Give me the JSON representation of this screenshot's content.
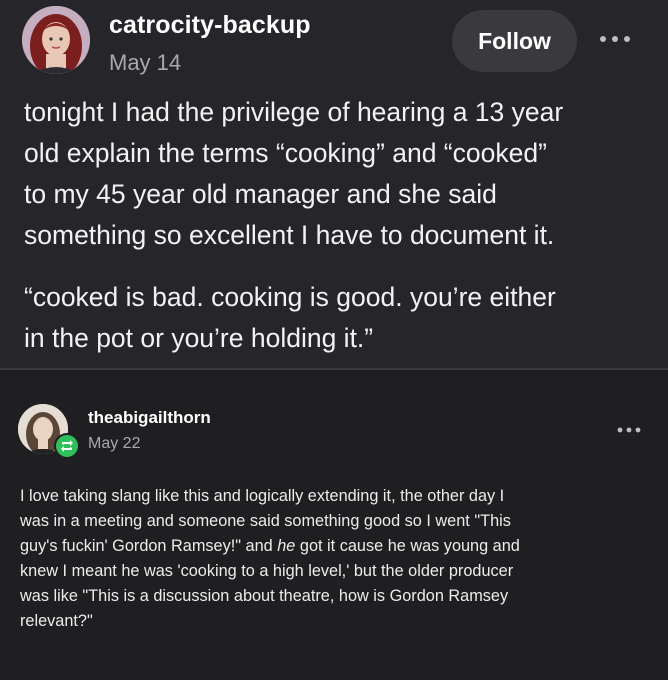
{
  "post": {
    "username": "catrocity-backup",
    "date": "May 14",
    "follow_label": "Follow",
    "more_icon": "ellipsis-icon",
    "body_lines": [
      "tonight I had the privilege of hearing a 13 year",
      "old explain the terms “cooking” and “cooked”",
      "to my 45 year old manager and she said",
      "something so excellent I have to document it."
    ],
    "quote_lines": [
      "“cooked is bad. cooking is good. you’re either",
      "in the pot or you’re holding it.”"
    ]
  },
  "reply": {
    "username": "theabigailthorn",
    "date": "May 22",
    "badge_icon": "reblog-icon",
    "more_icon": "ellipsis-icon",
    "lines": [
      "I love taking slang like this and logically extending it, the other day I",
      "was in a meeting and someone said something good so I went \"This",
      "guy's fuckin' Gordon Ramsey!\" and ",
      "he",
      " got it cause he was young and",
      "knew I meant he was 'cooking to a high level,' but the older producer",
      "was like \"This is a discussion about theatre, how is Gordon Ramsey",
      "relevant?\""
    ]
  },
  "colors": {
    "post_bg": "#26262a",
    "reply_bg": "#1f1f22",
    "button_bg": "#3a3a3e",
    "badge": "#2fbf5b"
  }
}
